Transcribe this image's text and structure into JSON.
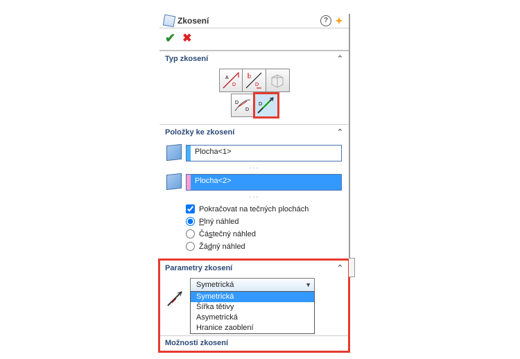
{
  "title": "Zkosení",
  "sections": {
    "type": {
      "title": "Typ zkosení"
    },
    "items": {
      "title": "Položky ke zkosení",
      "face1": "Plocha<1>",
      "face2": "Plocha<2>",
      "tangent": "Pokračovat na tečných plochách",
      "preview_full": "Plný náhled",
      "preview_partial": "Částečný náhled",
      "preview_none": "Žádný náhled"
    },
    "params": {
      "title": "Parametry zkosení",
      "selected": "Symetrická",
      "options": [
        "Symetrická",
        "Šířka tětivy",
        "Asymetrická",
        "Hranice zaoblení"
      ]
    },
    "options_section": "Možnosti zkosení"
  }
}
